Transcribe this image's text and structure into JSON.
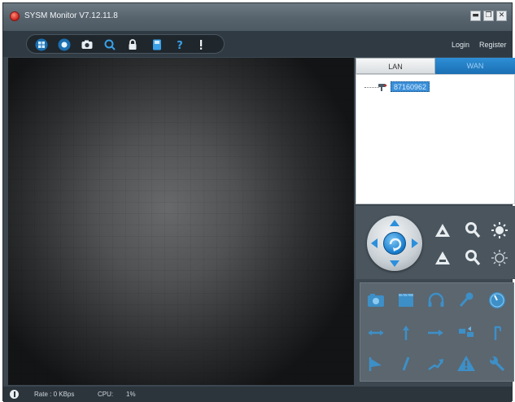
{
  "window": {
    "title": "SYSM Monitor   V7.12.11.8",
    "minimize_symbol": "▬",
    "restore_symbol": "❐",
    "close_symbol": "✕"
  },
  "toolbar": {
    "tools": [
      {
        "name": "layout-grid-icon"
      },
      {
        "name": "record-icon"
      },
      {
        "name": "snapshot-camera-icon"
      },
      {
        "name": "search-icon"
      },
      {
        "name": "lock-icon"
      },
      {
        "name": "save-disk-icon"
      },
      {
        "name": "help-icon"
      },
      {
        "name": "info-icon"
      }
    ],
    "login_label": "Login",
    "register_label": "Register"
  },
  "device_panel": {
    "tabs": [
      {
        "label": "LAN",
        "active": true
      },
      {
        "label": "WAN",
        "active": false
      }
    ],
    "devices": [
      {
        "label": "87160962",
        "icon": "network-camera-icon",
        "selected": true
      }
    ]
  },
  "ptz": {
    "joystick_icon": "refresh-icon",
    "buttons": [
      "focus-up-icon",
      "zoom-in-icon",
      "brightness-up-icon",
      "focus-down-icon",
      "zoom-out-icon",
      "brightness-down-icon"
    ]
  },
  "functions": [
    "photo-icon",
    "video-clip-icon",
    "headphones-icon",
    "microphone-icon",
    "volume-icon",
    "resize-horizontal-icon",
    "arrow-up-icon",
    "arrow-right-icon",
    "transfer-icon",
    "flip-icon",
    "flag-icon",
    "pen-icon",
    "trend-arrow-icon",
    "alarm-warning-icon",
    "wrench-icon"
  ],
  "status": {
    "rate_label": "Rate : 0 KBps",
    "cpu_label": "CPU:",
    "cpu_value": "1%"
  },
  "colors": {
    "accent_blue": "#2e8fd6",
    "panel_dark": "#3c4750",
    "icon_blue": "#3aa0e8"
  }
}
